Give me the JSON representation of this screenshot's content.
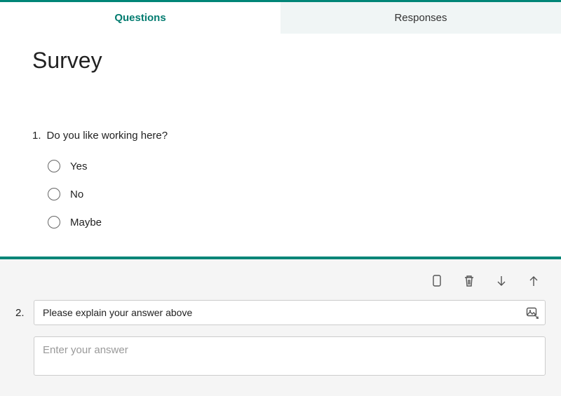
{
  "tabs": {
    "questions": "Questions",
    "responses": "Responses"
  },
  "form": {
    "title": "Survey"
  },
  "question1": {
    "number": "1.",
    "text": "Do you like working here?",
    "options": [
      "Yes",
      "No",
      "Maybe"
    ]
  },
  "question2": {
    "number": "2.",
    "text": "Please explain your answer above",
    "answer_placeholder": "Enter your answer"
  }
}
